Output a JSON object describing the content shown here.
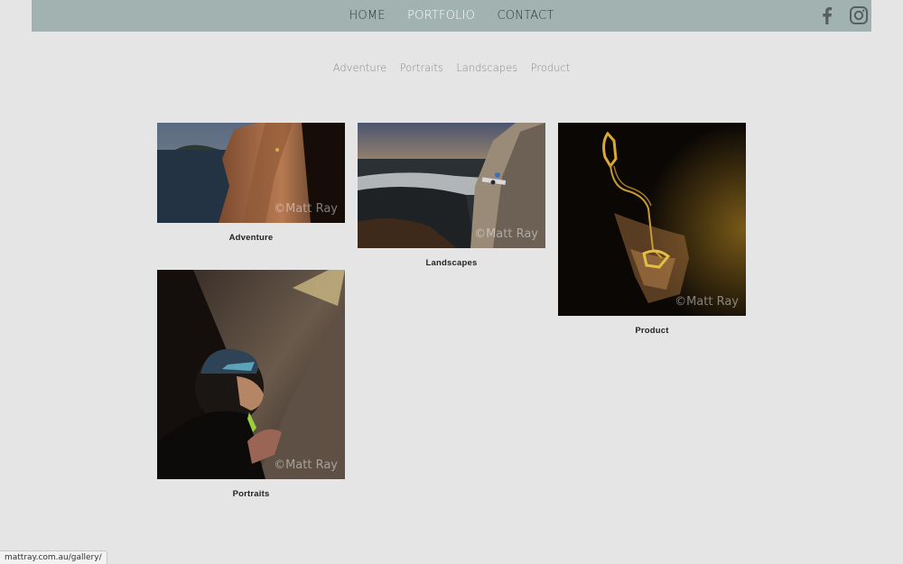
{
  "nav": {
    "items": [
      {
        "label": "HOME",
        "active": false
      },
      {
        "label": "PORTFOLIO",
        "active": true
      },
      {
        "label": "CONTACT",
        "active": false
      }
    ],
    "social": [
      "facebook-icon",
      "instagram-icon"
    ]
  },
  "subnav": [
    "Adventure",
    "Portraits",
    "Landscapes",
    "Product"
  ],
  "gallery": [
    {
      "caption": "Adventure",
      "watermark": "©Matt Ray"
    },
    {
      "caption": "Landscapes",
      "watermark": "©Matt Ray"
    },
    {
      "caption": "Product",
      "watermark": "©Matt Ray"
    },
    {
      "caption": "Portraits",
      "watermark": "©Matt Ray"
    }
  ],
  "status_url": "mattray.com.au/gallery/",
  "colors": {
    "topbar": "#a2b2b1",
    "background": "#e5e5e5",
    "active_nav": "#ffffff"
  }
}
